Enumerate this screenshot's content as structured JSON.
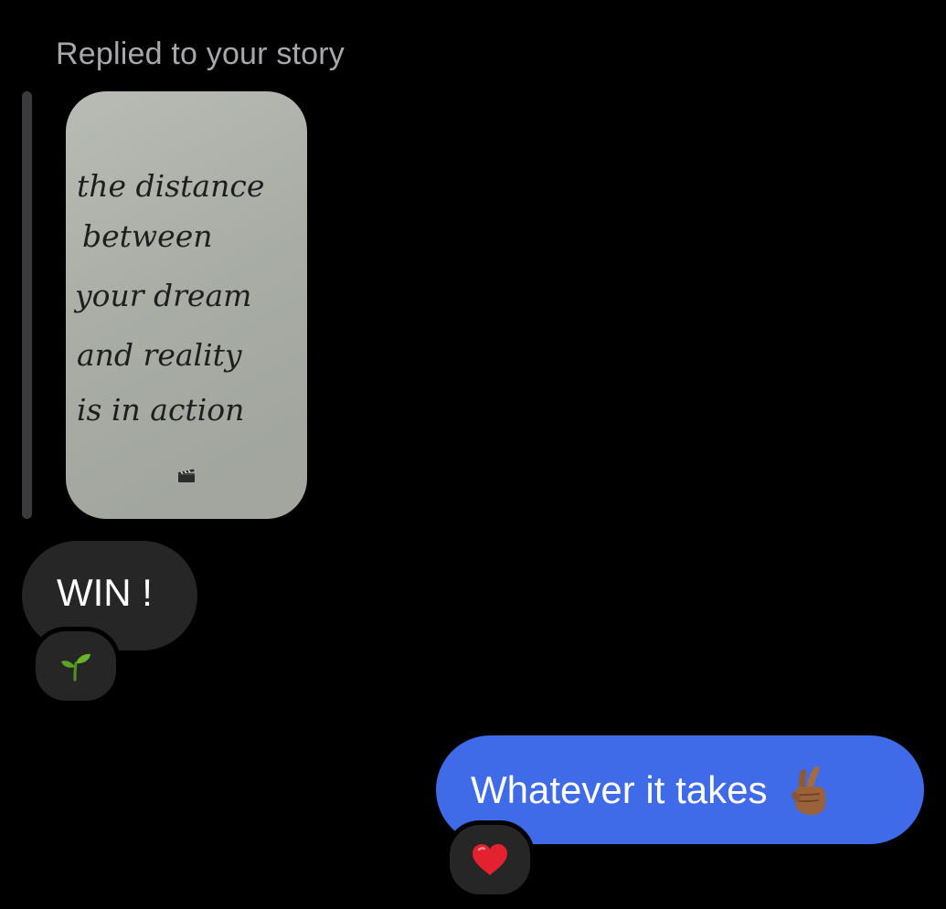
{
  "thread": {
    "reply_header": "Replied to your story"
  },
  "story": {
    "handwritten_lines": [
      "the distance",
      "between",
      "your dream",
      "and reality",
      "is in action"
    ],
    "media_icon": "clapper-board-icon"
  },
  "messages": [
    {
      "direction": "incoming",
      "text": "WIN !",
      "reaction_icon": "seedling-emoji-icon"
    },
    {
      "direction": "outgoing",
      "text": "Whatever it takes",
      "emoji_icon": "crossed-fingers-emoji-icon",
      "reaction_icon": "red-heart-emoji-icon"
    }
  ],
  "colors": {
    "background": "#000000",
    "incoming_bubble": "#262626",
    "outgoing_bubble": "#3f6ae8",
    "secondary_text": "#a8a8ac",
    "heart": "#e3212f",
    "seedling": "#6ab42b"
  }
}
